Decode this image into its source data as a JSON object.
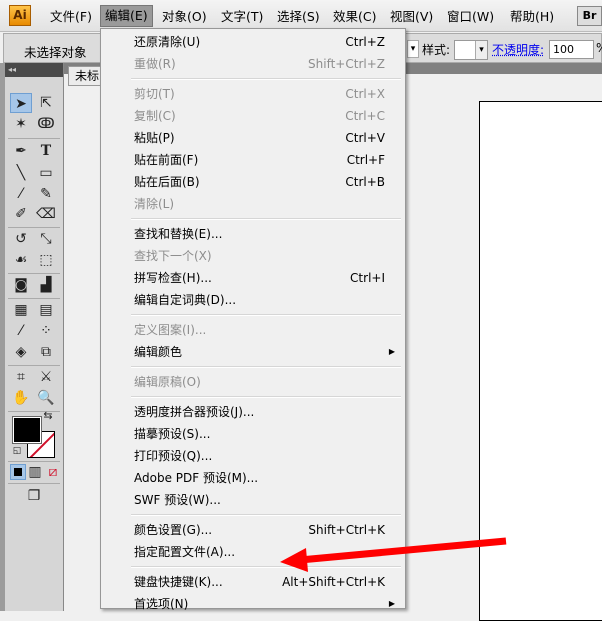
{
  "app": {
    "logo": "Ai",
    "bridge": "Br"
  },
  "menubar": [
    "文件(F)",
    "编辑(E)",
    "对象(O)",
    "文字(T)",
    "选择(S)",
    "效果(C)",
    "视图(V)",
    "窗口(W)",
    "帮助(H)"
  ],
  "control": {
    "no_selection": "未选择对象",
    "style_label": "样式:",
    "opacity_label": "不透明度:",
    "opacity_value": "100",
    "percent": "%"
  },
  "doc_tab": "未标",
  "menu": [
    [
      {
        "label": "还原清除(U)",
        "shortcut": "Ctrl+Z"
      },
      {
        "label": "重做(R)",
        "shortcut": "Shift+Ctrl+Z",
        "disabled": true
      }
    ],
    [
      {
        "label": "剪切(T)",
        "shortcut": "Ctrl+X",
        "disabled": true
      },
      {
        "label": "复制(C)",
        "shortcut": "Ctrl+C",
        "disabled": true
      },
      {
        "label": "粘贴(P)",
        "shortcut": "Ctrl+V"
      },
      {
        "label": "贴在前面(F)",
        "shortcut": "Ctrl+F"
      },
      {
        "label": "贴在后面(B)",
        "shortcut": "Ctrl+B"
      },
      {
        "label": "清除(L)",
        "disabled": true
      }
    ],
    [
      {
        "label": "查找和替换(E)..."
      },
      {
        "label": "查找下一个(X)",
        "disabled": true
      },
      {
        "label": "拼写检查(H)...",
        "shortcut": "Ctrl+I"
      },
      {
        "label": "编辑自定词典(D)..."
      }
    ],
    [
      {
        "label": "定义图案(I)...",
        "disabled": true
      },
      {
        "label": "编辑颜色",
        "submenu": true
      }
    ],
    [
      {
        "label": "编辑原稿(O)",
        "disabled": true
      }
    ],
    [
      {
        "label": "透明度拼合器预设(J)..."
      },
      {
        "label": "描摹预设(S)..."
      },
      {
        "label": "打印预设(Q)..."
      },
      {
        "label": "Adobe PDF 预设(M)..."
      },
      {
        "label": "SWF 预设(W)..."
      }
    ],
    [
      {
        "label": "颜色设置(G)...",
        "shortcut": "Shift+Ctrl+K"
      },
      {
        "label": "指定配置文件(A)..."
      }
    ],
    [
      {
        "label": "键盘快捷键(K)...",
        "shortcut": "Alt+Shift+Ctrl+K"
      },
      {
        "label": "首选项(N)",
        "submenu": true
      }
    ]
  ],
  "colors": {
    "arrow": "#ff0000",
    "link": "#0000ee"
  }
}
